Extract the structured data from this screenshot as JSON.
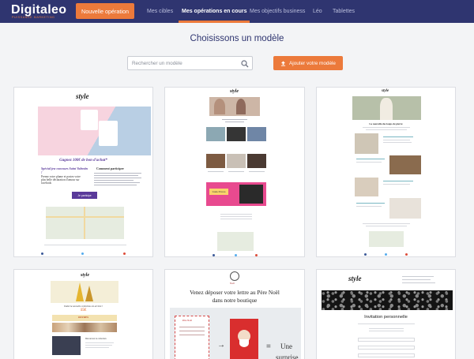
{
  "brand": {
    "name": "Digitaleo",
    "tagline": "PUISSANCE MARKETING",
    "accent": "#ec7a3b",
    "nav_bg": "#2f3570"
  },
  "topbar": {
    "new_button": "Nouvelle opération",
    "nav": [
      "Mes cibles",
      "Mes opérations en cours",
      "Mes objectifs business",
      "Léo",
      "Tablettes"
    ],
    "active_nav": "Mes opérations en cours"
  },
  "page": {
    "title": "Choisissons un modèle",
    "search_placeholder": "Rechercher un modèle",
    "add_button": "Ajouter votre modèle"
  },
  "templates": [
    {
      "brand_mark": "style",
      "headline": "Gagnez 100€ de bon d'achat*",
      "left_title": "Spécial jeu-concours Saint Valentin !",
      "left_text": "Prenez votre plume et postez votre plus belle déclaration d'amour sur facebook",
      "right_title": "Comment participer",
      "cta": "Je participe"
    },
    {
      "brand_mark": "style",
      "promo_label": "Code Promo"
    },
    {
      "brand_mark": "style",
      "caption": "La nouvelle des loups de pierre"
    },
    {
      "brand_mark": "style",
      "headline": "Outlet la nouvelle collection est arrivée !",
      "price": "15€",
      "offer_title": "OFFRES",
      "offer_sub": "Découvrez la collection"
    },
    {
      "brand_mark": "Noël",
      "headline_1": "Venez déposer votre lettre au Père Noël",
      "headline_2": "dans notre boutique",
      "letter_label": "Père Noël",
      "equals": "=",
      "surprise_1": "Une",
      "surprise_2": "surprise"
    },
    {
      "brand_mark": "style",
      "headline": "Invitation personnelle"
    }
  ]
}
